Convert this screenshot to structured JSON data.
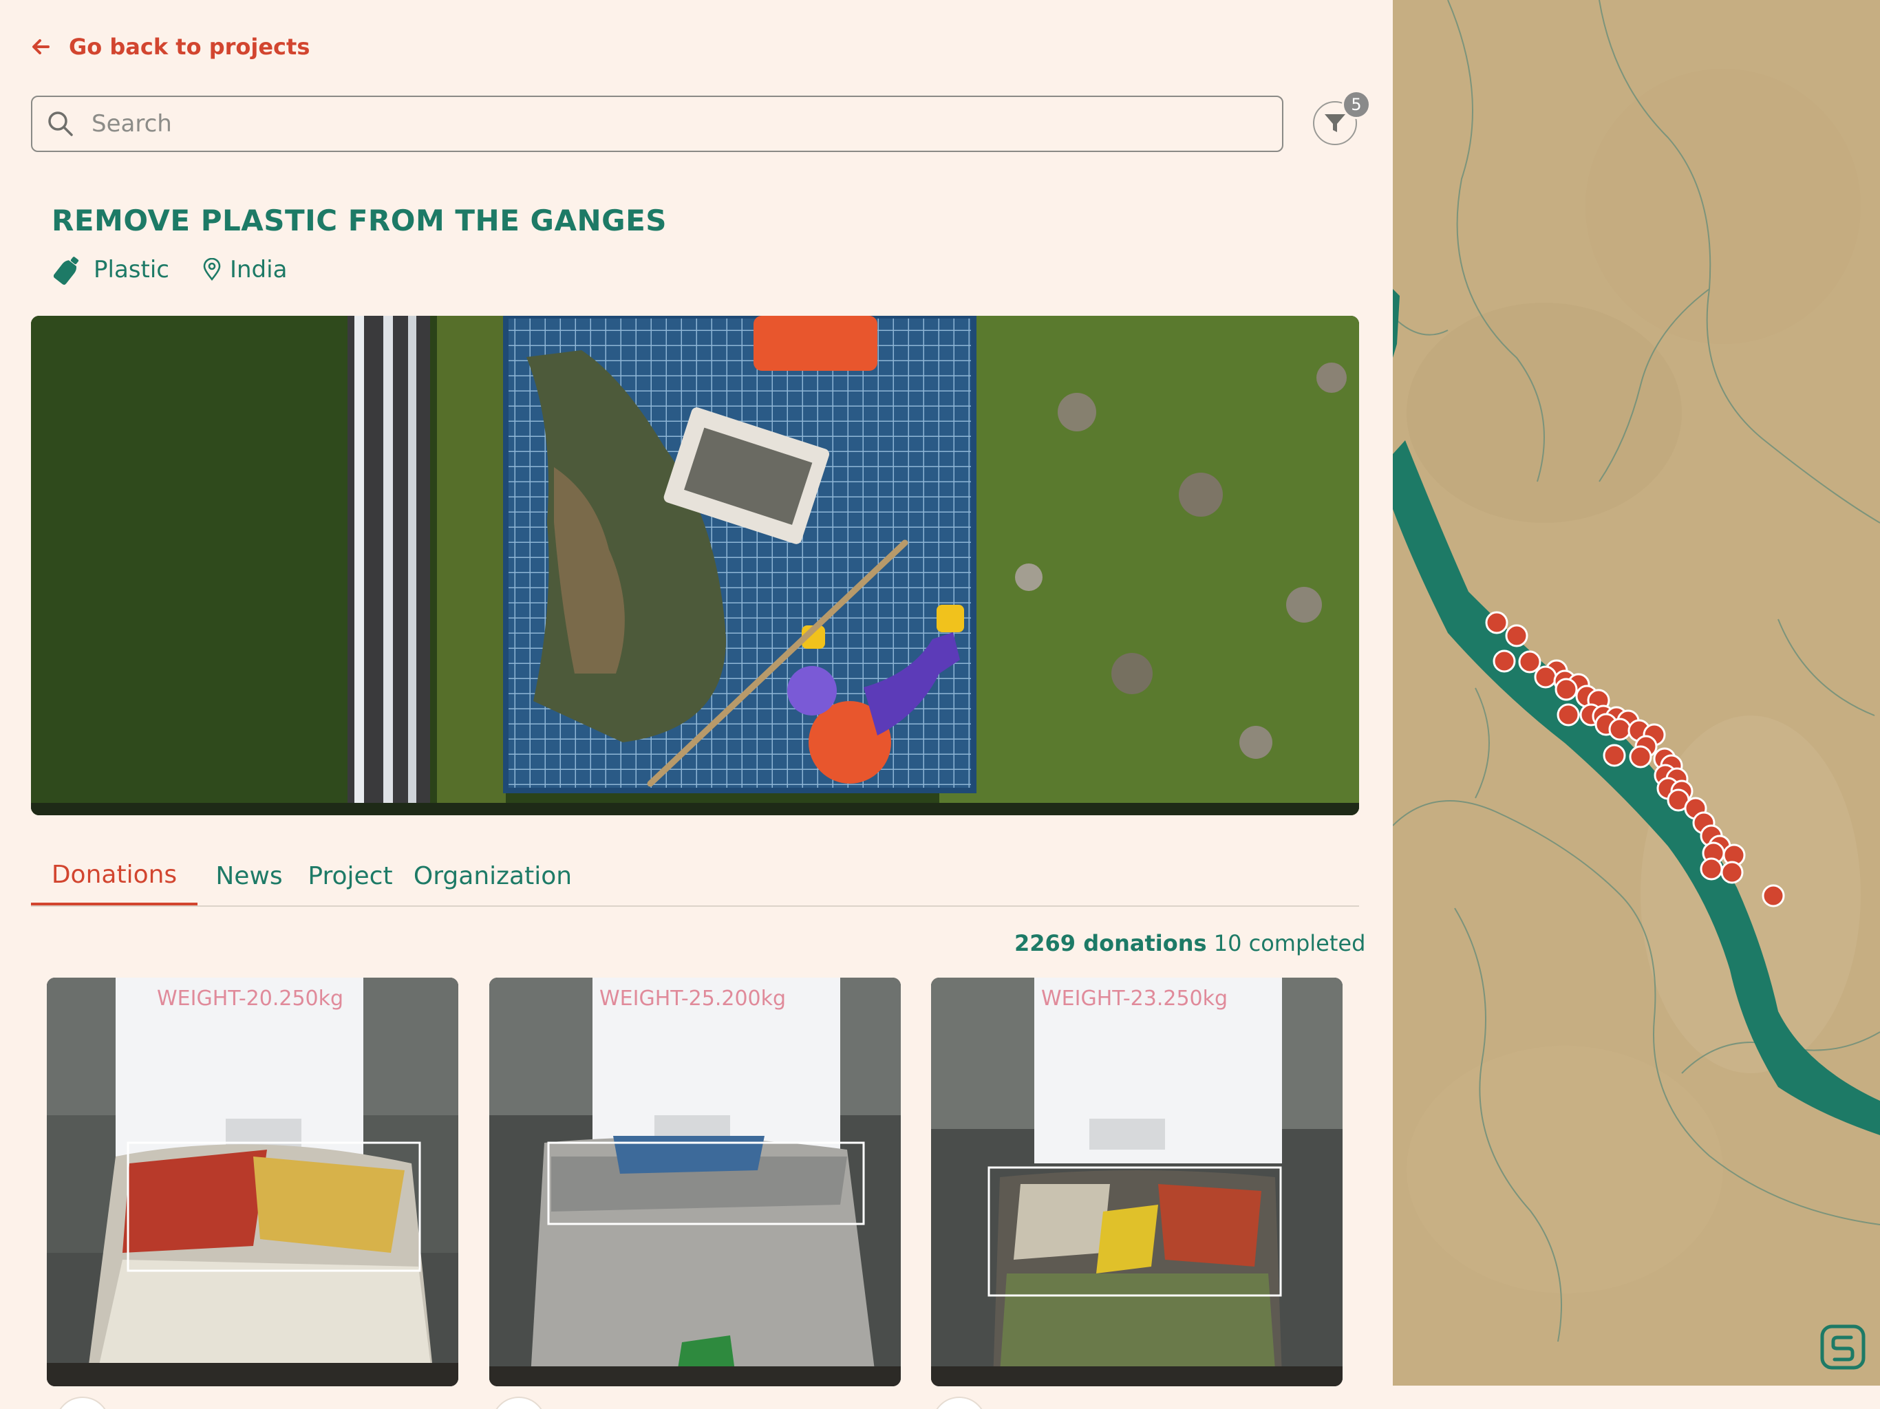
{
  "nav": {
    "back_label": "Go back to projects"
  },
  "search": {
    "placeholder": "Search"
  },
  "filter": {
    "badge_count": "5"
  },
  "project": {
    "title": "REMOVE PLASTIC FROM THE GANGES",
    "category": "Plastic",
    "location": "India"
  },
  "tabs": [
    {
      "label": "Donations",
      "active": true
    },
    {
      "label": "News",
      "active": false
    },
    {
      "label": "Project",
      "active": false
    },
    {
      "label": "Organization",
      "active": false
    }
  ],
  "donations": {
    "count_text": "2269 donations",
    "completed_text": "10 completed",
    "cards": [
      {
        "photo_label": "WEIGHT-20.250kg"
      },
      {
        "photo_label": "WEIGHT-25.200kg"
      },
      {
        "photo_label": "WEIGHT-23.250kg"
      }
    ]
  },
  "colors": {
    "accent_red": "#d2452f",
    "brand_green": "#1d7a66",
    "background": "#fdf2ea",
    "map_land": "#c6ae82",
    "map_river": "#1d7a66"
  },
  "icons": {
    "back": "arrow-left-icon",
    "search": "search-icon",
    "filter": "filter-icon",
    "category": "bottle-icon",
    "location": "map-pin-icon",
    "map_logo": "app-logo-icon"
  }
}
